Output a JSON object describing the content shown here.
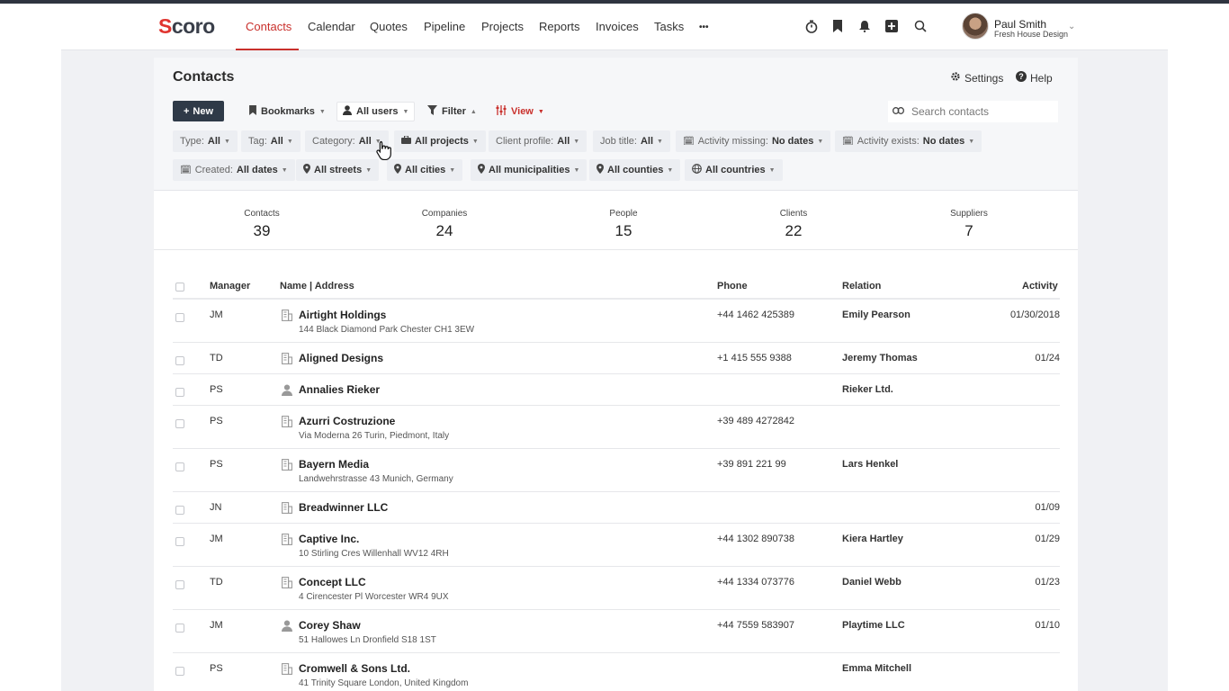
{
  "app": {
    "logo": "Scoro",
    "nav": [
      "Contacts",
      "Calendar",
      "Quotes",
      "Pipeline",
      "Projects",
      "Reports",
      "Invoices",
      "Tasks"
    ],
    "more": "•••",
    "icons": [
      "timer-icon",
      "bookmark-icon",
      "bell-icon",
      "add-icon",
      "search-icon"
    ],
    "user": {
      "name": "Paul Smith",
      "company": "Fresh House Design"
    }
  },
  "page": {
    "title": "Contacts",
    "settings": "Settings",
    "help": "Help",
    "new_button": "New",
    "toolbar": {
      "bookmarks": "Bookmarks",
      "users": "All users",
      "filter": "Filter",
      "view": "View"
    },
    "search_placeholder": "Search contacts"
  },
  "filters": {
    "row1": [
      {
        "label": "Type:",
        "value": "All"
      },
      {
        "label": "Tag:",
        "value": "All"
      },
      {
        "label": "Category:",
        "value": "All"
      },
      {
        "label": "",
        "value": "All projects"
      },
      {
        "label": "Client profile:",
        "value": "All"
      },
      {
        "label": "Job title:",
        "value": "All"
      },
      {
        "label": "Activity missing:",
        "value": "No dates"
      },
      {
        "label": "Activity exists:",
        "value": "No dates"
      }
    ],
    "row2": [
      {
        "label": "Created:",
        "value": "All dates"
      },
      {
        "label": "",
        "value": "All streets"
      },
      {
        "label": "",
        "value": "All cities"
      },
      {
        "label": "",
        "value": "All municipalities"
      },
      {
        "label": "",
        "value": "All counties"
      },
      {
        "label": "",
        "value": "All countries"
      }
    ]
  },
  "stats": [
    {
      "label": "Contacts",
      "value": "39"
    },
    {
      "label": "Companies",
      "value": "24"
    },
    {
      "label": "People",
      "value": "15"
    },
    {
      "label": "Clients",
      "value": "22"
    },
    {
      "label": "Suppliers",
      "value": "7"
    }
  ],
  "table": {
    "headers": {
      "manager": "Manager",
      "name": "Name | Address",
      "phone": "Phone",
      "relation": "Relation",
      "activity": "Activity"
    },
    "rows": [
      {
        "manager": "JM",
        "type": "company",
        "name": "Airtight Holdings",
        "address": "144 Black Diamond Park Chester CH1 3EW",
        "phone": "+44 1462 425389",
        "relation": "Emily Pearson",
        "activity": "01/30/2018"
      },
      {
        "manager": "TD",
        "type": "company",
        "name": "Aligned Designs",
        "address": "",
        "phone": "+1 415 555 9388",
        "relation": "Jeremy Thomas",
        "activity": "01/24"
      },
      {
        "manager": "PS",
        "type": "person",
        "name": "Annalies Rieker",
        "address": "",
        "phone": "",
        "relation": "Rieker Ltd.",
        "activity": ""
      },
      {
        "manager": "PS",
        "type": "company",
        "name": "Azurri Costruzione",
        "address": "Via Moderna 26 Turin, Piedmont, Italy",
        "phone": "+39 489 4272842",
        "relation": "",
        "activity": ""
      },
      {
        "manager": "PS",
        "type": "company",
        "name": "Bayern Media",
        "address": "Landwehrstrasse 43 Munich, Germany",
        "phone": "+39 891 221 99",
        "relation": "Lars Henkel",
        "activity": ""
      },
      {
        "manager": "JN",
        "type": "company",
        "name": "Breadwinner LLC",
        "address": "",
        "phone": "",
        "relation": "",
        "activity": "01/09"
      },
      {
        "manager": "JM",
        "type": "company",
        "name": "Captive Inc.",
        "address": "10 Stirling Cres Willenhall WV12 4RH",
        "phone": "+44 1302 890738",
        "relation": "Kiera Hartley",
        "activity": "01/29"
      },
      {
        "manager": "TD",
        "type": "company",
        "name": "Concept LLC",
        "address": "4 Cirencester Pl Worcester WR4 9UX",
        "phone": "+44 1334 073776",
        "relation": "Daniel Webb",
        "activity": "01/23"
      },
      {
        "manager": "JM",
        "type": "person",
        "name": "Corey Shaw",
        "address": "51 Hallowes Ln Dronfield S18 1ST",
        "phone": "+44 7559 583907",
        "relation": "Playtime LLC",
        "activity": "01/10"
      },
      {
        "manager": "PS",
        "type": "company",
        "name": "Cromwell & Sons Ltd.",
        "address": "41 Trinity Square London, United Kingdom",
        "phone": "",
        "relation": "Emma Mitchell",
        "activity": ""
      }
    ]
  },
  "colors": {
    "accent": "#c9302c",
    "dark_button": "#2f3a48",
    "chip_bg": "#eceef2"
  }
}
